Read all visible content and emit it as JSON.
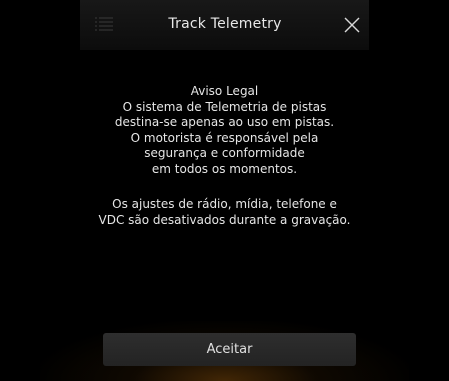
{
  "header": {
    "title": "Track Telemetry",
    "menu_icon": "menu-icon",
    "close_icon": "close-icon"
  },
  "notice": {
    "lines": [
      "Aviso Legal",
      "O sistema de Telemetria de pistas",
      "destina-se apenas ao uso em pistas.",
      "O motorista é responsável pela",
      "segurança e conformidade",
      "em todos os momentos."
    ]
  },
  "settings_notice": {
    "lines": [
      "Os ajustes de rádio, mídia, telefone e",
      "VDC são desativados durante a gravação."
    ]
  },
  "footer": {
    "accept_label": "Aceitar"
  },
  "colors": {
    "background": "#000000",
    "text": "#e6e6e6",
    "button": "#2a2a2a",
    "glow": "#78460a"
  }
}
